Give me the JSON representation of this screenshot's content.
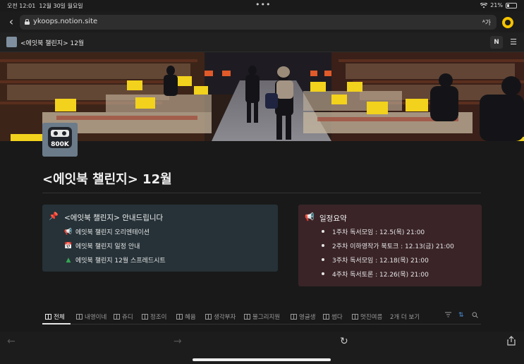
{
  "status_bar": {
    "time": "오전 12:01",
    "date": "12월 30일 월요일",
    "dots": "•••",
    "battery": "21%",
    "battery_level": 0.21
  },
  "browser": {
    "url": "ykoops.notion.site",
    "reader_label": "가",
    "reader_prefix": "ᴬ"
  },
  "notion_top": {
    "title": "<에잇북 챌린지> 12월",
    "notion_button": "N",
    "menu_icon": "menu-icon"
  },
  "page": {
    "icon_text": "800K",
    "title": "<에잇북 챌린지> 12월"
  },
  "callout_left": {
    "icon": "📌",
    "heading": "<에잇북 챌린지> 안내드립니다",
    "links": [
      {
        "icon": "📢",
        "label": "에잇북 챌린지 오리엔테이션"
      },
      {
        "icon": "📅",
        "label": "에잇북 챌린지 일정 안내"
      },
      {
        "icon": "▲",
        "label": "에잇북 챌린지 12월 스프레드시트"
      }
    ]
  },
  "callout_right": {
    "icon": "📢",
    "heading": "일정요약",
    "items": [
      "1주차 독서모임 : 12.5(목) 21:00",
      "2주차 이하영작가 북토크 : 12.13(금) 21:00",
      "3주차 독서모임 : 12.18(목) 21:00",
      "4주차 독서토론 : 12.26(목) 21:00"
    ]
  },
  "tabs": {
    "items": [
      "전체",
      "내영이네",
      "쥬디",
      "정조이",
      "혜윰",
      "생각부자",
      "물그리지원",
      "영글생",
      "썸다",
      "멋진여름"
    ],
    "more": "2개 더 보기",
    "active_index": 0
  },
  "colors": {
    "background": "#191919",
    "callout_left_bg": "#263238",
    "callout_right_bg": "#3a2428",
    "accent_yellow": "#f5c400"
  }
}
